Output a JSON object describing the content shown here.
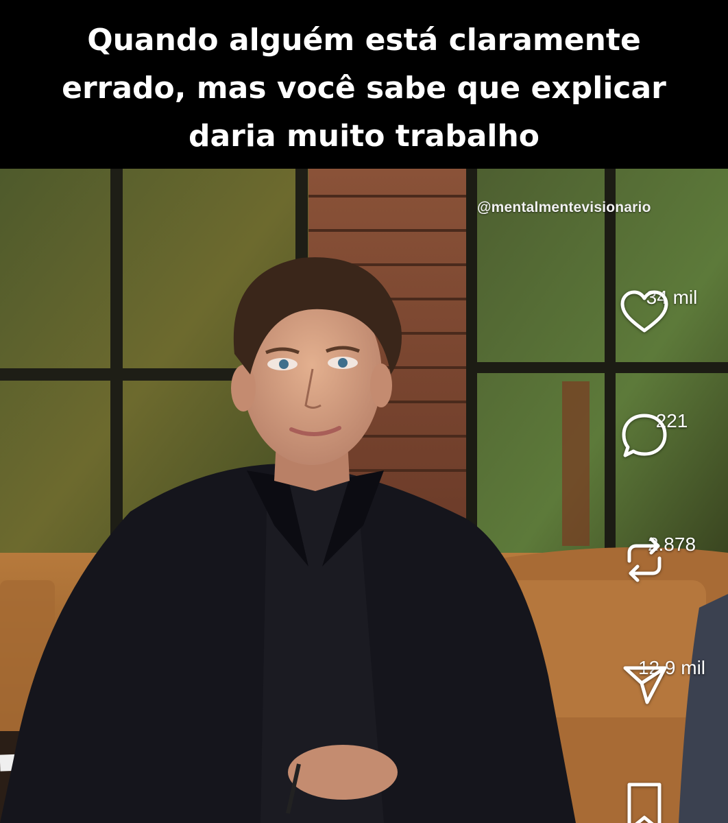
{
  "post": {
    "caption": "Quando alguém está claramente errado, mas você sabe que explicar daria muito trabalho",
    "watermark": "@mentalmentevisionario"
  },
  "actions": {
    "like": {
      "icon": "heart-icon",
      "count": "34 mil"
    },
    "comment": {
      "icon": "comment-bubble-icon",
      "count": "221"
    },
    "repost": {
      "icon": "repost-arrows-icon",
      "count": "2.878"
    },
    "share": {
      "icon": "paper-plane-icon",
      "count": "12,9 mil"
    },
    "save": {
      "icon": "bookmark-icon"
    }
  }
}
